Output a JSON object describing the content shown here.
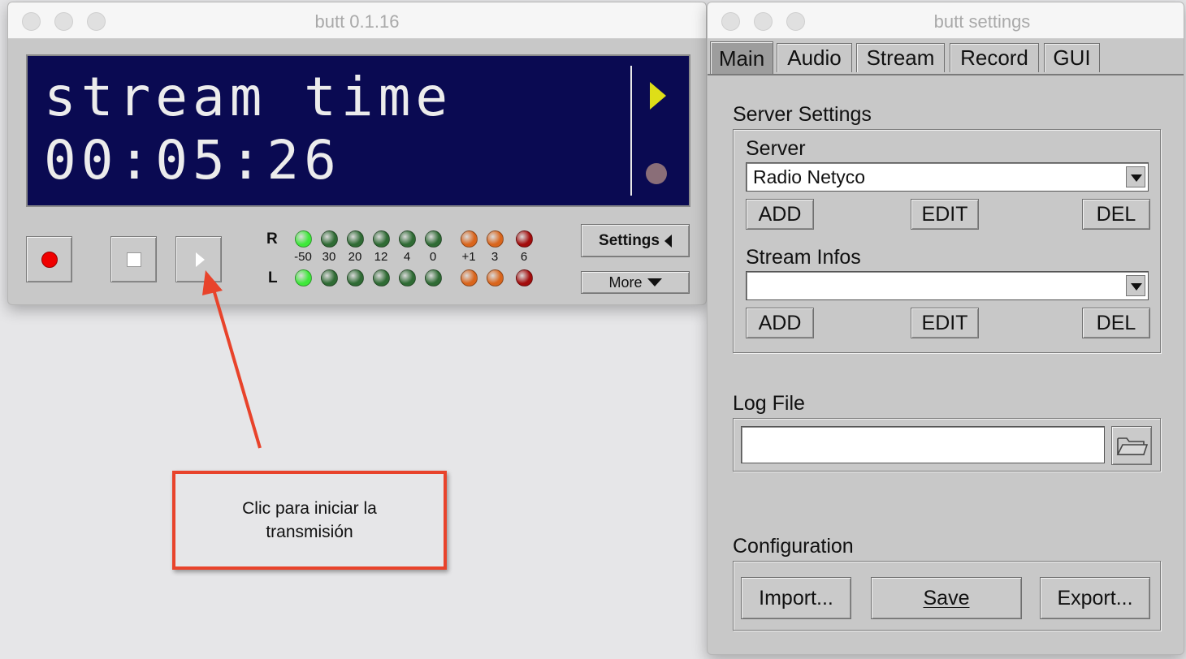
{
  "main_window": {
    "title": "butt 0.1.16",
    "lcd": {
      "line1": "stream time",
      "line2": "00:05:26"
    },
    "vu_meter": {
      "right_label": "R",
      "left_label": "L",
      "scale": [
        "-50",
        "30",
        "20",
        "12",
        "4",
        "0",
        "+1",
        "3",
        "6"
      ],
      "lit_segments": 1,
      "colors": {
        "green_lit": "#3ee83a",
        "green_dim": "#2f6b34",
        "orange": "#d9651c",
        "red": "#a30d0d"
      }
    },
    "settings_button": "Settings",
    "more_button": "More"
  },
  "annotation": {
    "text": "Clic para iniciar la transmisión",
    "color": "#e8432b"
  },
  "settings_window": {
    "title": "butt settings",
    "tabs": [
      "Main",
      "Audio",
      "Stream",
      "Record",
      "GUI"
    ],
    "active_tab": "Main",
    "server_settings": {
      "title": "Server Settings",
      "server_label": "Server",
      "server_value": "Radio Netyco",
      "stream_infos_label": "Stream Infos",
      "stream_infos_value": "",
      "add": "ADD",
      "edit": "EDIT",
      "del": "DEL"
    },
    "log_file": {
      "title": "Log File",
      "value": ""
    },
    "configuration": {
      "title": "Configuration",
      "import": "Import...",
      "save": "Save",
      "export": "Export..."
    }
  }
}
